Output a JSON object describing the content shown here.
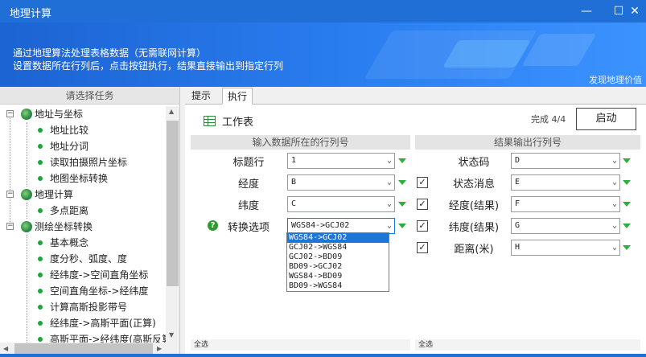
{
  "window": {
    "title": "地理计算",
    "minimize_glyph": "—",
    "maximize_glyph": "☐",
    "close_glyph": "✕"
  },
  "banner": {
    "line1": "通过地理算法处理表格数据（无需联网计算）",
    "line2": "设置数据所在行列后，点击按钮执行，结果直接输出到指定行列",
    "link": "发现地理价值"
  },
  "left_panel": {
    "header": "请选择任务",
    "groups": [
      {
        "label": "地址与坐标",
        "items": [
          "地址比较",
          "地址分词",
          "读取拍摄照片坐标",
          "地图坐标转换"
        ]
      },
      {
        "label": "地理计算",
        "items": [
          "多点距离"
        ]
      },
      {
        "label": "测绘坐标转换",
        "items": [
          "基本概念",
          "度分秒、弧度、度",
          "经纬度->空间直角坐标",
          "空间直角坐标->经纬度",
          "计算高斯投影带号",
          "经纬度->高斯平面(正算)",
          "高斯平面->经纬度(高斯反算)"
        ]
      }
    ]
  },
  "tabs": [
    {
      "label": "提示"
    },
    {
      "label": "执行"
    }
  ],
  "worksheet": {
    "title": "工作表",
    "status": "完成  4/4",
    "run_label": "启动"
  },
  "input_section": {
    "header": "输入数据所在的行列号",
    "rows": [
      {
        "label": "标题行",
        "value": "1"
      },
      {
        "label": "经度",
        "value": "B"
      },
      {
        "label": "纬度",
        "value": "C"
      },
      {
        "label": "转换选项",
        "value": "WGS84->GCJ02"
      }
    ],
    "footer": "全选"
  },
  "output_section": {
    "header": "结果输出行列号",
    "rows": [
      {
        "label": "状态码",
        "value": "D",
        "checked": false
      },
      {
        "label": "状态消息",
        "value": "E",
        "checked": true
      },
      {
        "label": "经度(结果)",
        "value": "F",
        "checked": true
      },
      {
        "label": "纬度(结果)",
        "value": "G",
        "checked": true
      },
      {
        "label": "距离(米)",
        "value": "H",
        "checked": true
      }
    ],
    "footer": "全选"
  },
  "conversion_options": [
    "WGS84->GCJ02",
    "GCJ02->WGS84",
    "GCJ02->BD09",
    "BD09->GCJ02",
    "WGS84->BD09",
    "BD09->WGS84"
  ],
  "check_glyph": "✓",
  "chevron_glyph": "⌄",
  "help_glyph": "?",
  "colors": {
    "accent": "#1f6fd6",
    "green": "#2fae3e",
    "selected": "#1e75d8"
  }
}
